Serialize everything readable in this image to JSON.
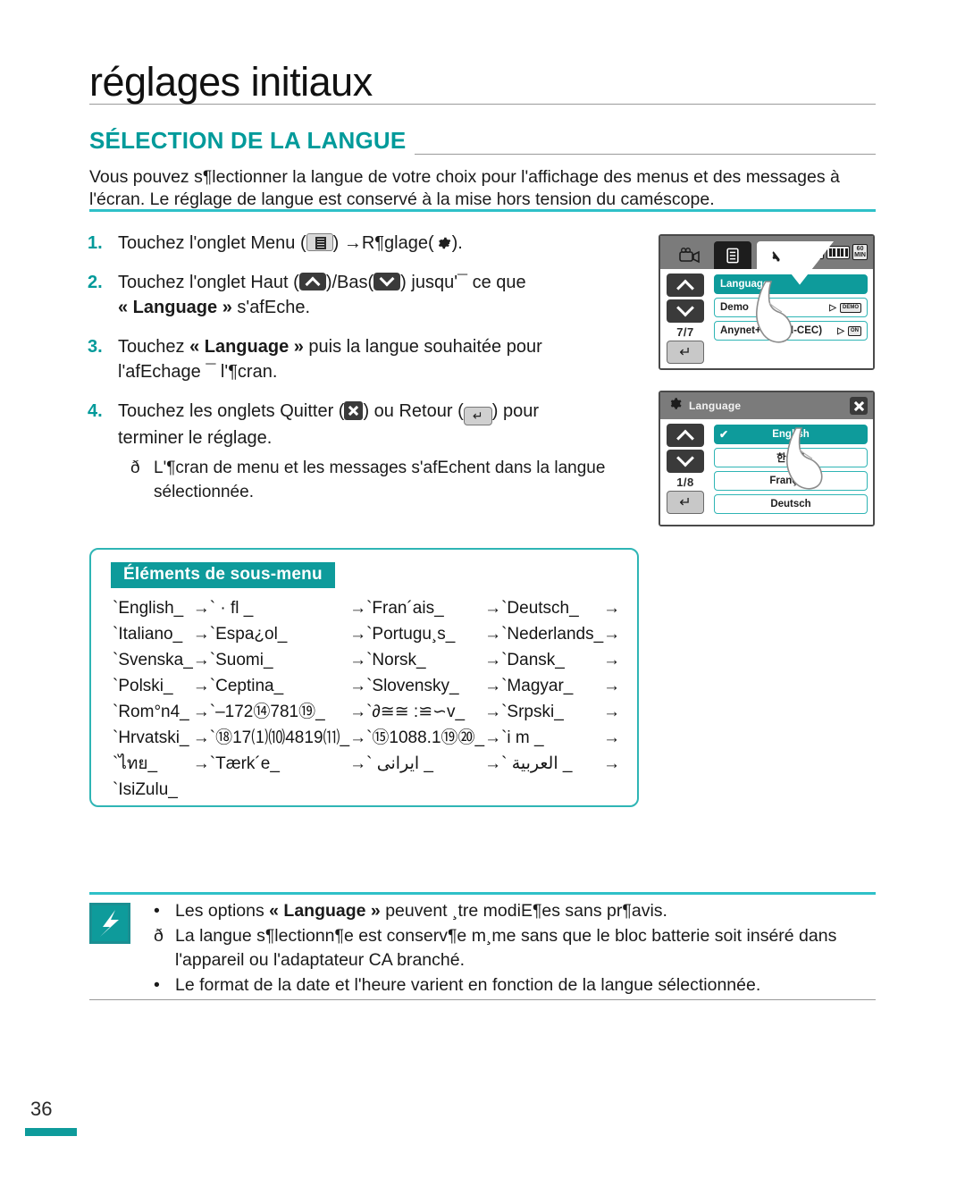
{
  "page": {
    "title": "réglages initiaux",
    "section_heading": "SÉLECTION DE LA LANGUE",
    "intro": "Vous pouvez s¶lectionner la langue de votre choix pour l'affichage des menus et des messages à l'écran. Le réglage de langue est conservé à la mise hors tension du caméscope.",
    "number": "36"
  },
  "steps": [
    {
      "num": "1.",
      "pre": "Touchez l'onglet Menu (",
      "mid": ") →R¶glage(",
      "post": ")."
    },
    {
      "num": "2.",
      "pre": "Touchez l'onglet Haut (",
      "mid": ")/Bas(",
      "post": ") jusqu'¯ ce que",
      "line2_bold": "« Language »",
      "line2_rest": " s'afEche."
    },
    {
      "num": "3.",
      "pre": "Touchez ",
      "bold": "« Language »",
      "post": " puis la langue souhaitée pour",
      "line2": "l'afEchage ¯ l'¶cran."
    },
    {
      "num": "4.",
      "pre": "Touchez les onglets Quitter (",
      "mid": ") ou Retour (",
      "post": ") pour",
      "line2": "terminer le réglage.",
      "sub_bullet": "ð",
      "sub_text": "L'¶cran de menu et les messages s'afEchent dans la langue sélectionnée."
    }
  ],
  "screen_settings": {
    "name": "settings-menu-screen",
    "tabs": [
      "camcorder-icon",
      "list-icon",
      "gear-icon"
    ],
    "status": {
      "battery_label": "60 MIN"
    },
    "pager": "7/7",
    "rows": [
      {
        "label": "Language",
        "selected": true,
        "tail": ""
      },
      {
        "label": "Demo",
        "selected": false,
        "tail": "DEMO"
      },
      {
        "label": "Anynet+ (HDMI-CEC)",
        "selected": false,
        "tail": "ON"
      }
    ]
  },
  "screen_language": {
    "name": "language-select-screen",
    "title": "Language",
    "pager": "1/8",
    "rows": [
      {
        "label": "English",
        "selected": true,
        "check": "✔"
      },
      {
        "label": "한국어",
        "selected": false
      },
      {
        "label": "Français",
        "selected": false
      },
      {
        "label": "Deutsch",
        "selected": false
      }
    ]
  },
  "submenu": {
    "title": "Éléments de sous-menu",
    "arrow": "→",
    "rows": [
      [
        "`English_",
        "` · fl   _",
        "`Fran´ais_",
        "`Deutsch_"
      ],
      [
        "`Italiano_",
        "`Espa¿ol_",
        "`Portugu¸s_",
        "`Nederlands_"
      ],
      [
        "`Svenska_",
        "`Suomi_",
        "`Norsk_",
        "`Dansk_"
      ],
      [
        "`Polski_",
        "`Ceptina_",
        "`Slovensky_",
        "`Magyar_"
      ],
      [
        "`Rom°n4_",
        "`–172⑭781⑲_",
        "`∂≅≅ :≌∽v_",
        "`Srpski_"
      ],
      [
        "`Hrvatski_",
        "`⑱17⑴⑽4819⑾_",
        "`⑮1088.1⑲⑳_",
        "`i m _"
      ],
      [
        "`ไทย_",
        "`Tærk´e_",
        "` ايرانى  _",
        "` العربية  _"
      ],
      [
        "`IsiZulu_",
        "",
        "",
        ""
      ]
    ]
  },
  "notes": [
    {
      "bullet": "•",
      "pre": "Les options ",
      "bold": "« Language »",
      "post": " peuvent ¸tre modiE¶es sans pr¶avis."
    },
    {
      "bullet": "ð",
      "text": "La langue s¶lectionn¶e est conserv¶e m¸me sans que le bloc batterie soit inséré dans l'appareil ou l'adaptateur CA branché."
    },
    {
      "bullet": "•",
      "text": "Le format de la date et l'heure varient en fonction de la langue sélectionnée."
    }
  ],
  "colors": {
    "teal": "#0e9b9b",
    "teal_light": "#2fc0c8",
    "gray_bar": "#7b7b7b"
  }
}
